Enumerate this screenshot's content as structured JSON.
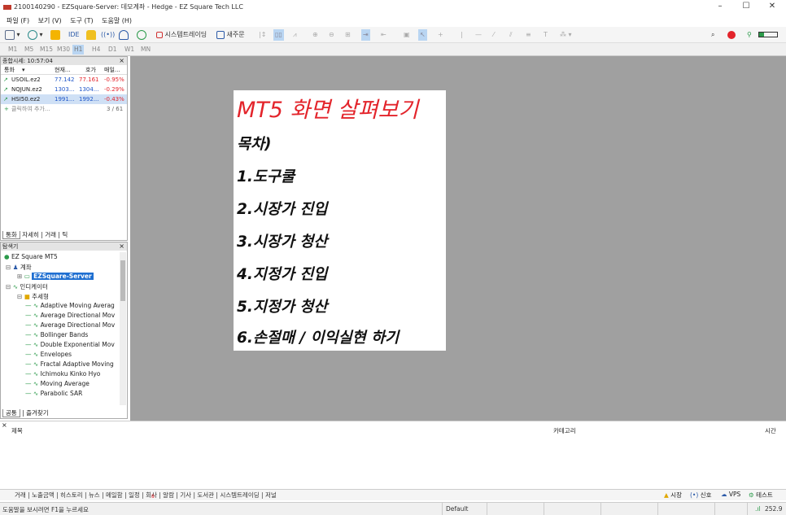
{
  "window": {
    "title": "2100140290 - EZSquare-Server: 데모계좌 - Hedge - EZ Square Tech LLC",
    "min": "–",
    "max": "☐",
    "close": "✕"
  },
  "menu": [
    "파일 (F)",
    "보기 (V)",
    "도구 (T)",
    "도움말 (H)"
  ],
  "toolbar": {
    "ide": "IDE",
    "algo_label": "시스템트레이딩",
    "new_order": "새주문"
  },
  "timeframes": [
    "M1",
    "M5",
    "M15",
    "M30",
    "H1",
    "H4",
    "D1",
    "W1",
    "MN"
  ],
  "timeframe_active": "H1",
  "market_watch": {
    "title": "종합시세: 10:57:04",
    "headers": [
      "통화",
      "현재...",
      "호가",
      "매일..."
    ],
    "rows": [
      {
        "symbol": "USOIL.ez2",
        "bid": "77.142",
        "ask": "77.161",
        "change": "-0.95%"
      },
      {
        "symbol": "NQJUN.ez2",
        "bid": "1303...",
        "ask": "1304...",
        "change": "-0.29%"
      },
      {
        "symbol": "HSI50.ez2",
        "bid": "1991...",
        "ask": "1992...",
        "change": "-0.43%"
      }
    ],
    "add_label": "클릭하여 추가...",
    "count": "3 / 61",
    "tabs": [
      "통화",
      "자세히",
      "거래",
      "틱"
    ]
  },
  "navigator": {
    "title": "탐색기",
    "root": "EZ Square MT5",
    "accounts": "계좌",
    "server": "EZSquare-Server",
    "indicators": "인디케이터",
    "trend": "추세형",
    "items": [
      "Adaptive Moving Averag",
      "Average Directional Mov",
      "Average Directional Mov",
      "Bollinger Bands",
      "Double Exponential Mov",
      "Envelopes",
      "Fractal Adaptive Moving",
      "Ichimoku Kinko Hyo",
      "Moving Average",
      "Parabolic SAR"
    ],
    "tabs": [
      "공통",
      "즐겨찾기"
    ]
  },
  "card": {
    "heading": "MT5 화면 살펴보기",
    "lines": [
      "목차)",
      "1.도구쿨",
      "2.시장가 진입",
      "3.시장가 청산",
      "4.지정가 진입",
      "5.지정가 청산",
      "6.손절매 / 이익실현 하기"
    ]
  },
  "toolbox": {
    "col_subject": "제목",
    "col_category": "카테고리",
    "col_time": "시간"
  },
  "bottom_tabs": "거래 | 노출금액 | 히스토리 | 뉴스 | 메일함 | 일정 | 회사 | 알람 | 기사 | 도서관 | 시스템트레이딩 | 저널",
  "mail_badge": "8",
  "bottom_right": {
    "market": "시장",
    "signals": "신호",
    "vps": "VPS",
    "tester": "테스트"
  },
  "status": {
    "help": "도움말을 보시려면 F1을 누르세요",
    "profile": "Default",
    "ping": "252.9"
  },
  "colors": {
    "accent_red": "#e3242b",
    "chart_bg": "#a0a0a0",
    "selection": "#3a7bd5",
    "positive": "#1f56c9",
    "negative": "#e3242b"
  }
}
